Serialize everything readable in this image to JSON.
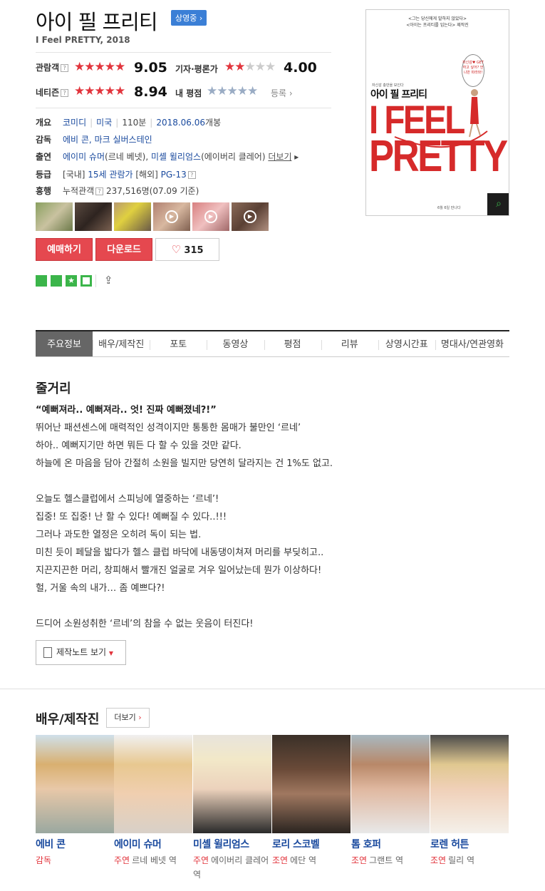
{
  "movie": {
    "title": "아이 필 프리티",
    "status_badge": "상영중",
    "subtitle": "I Feel PRETTY, 2018"
  },
  "ratings": {
    "audience_label": "관람객",
    "audience_score": "9.05",
    "critic_label": "기자·평론가",
    "critic_score": "4.00",
    "netizen_label": "네티즌",
    "netizen_score": "8.94",
    "my_rating_label": "내 평점",
    "register_label": "등록"
  },
  "info": {
    "summary_label": "개요",
    "genre": "코미디",
    "country": "미국",
    "runtime": "110분",
    "release": "2018.06.06",
    "release_suffix": "개봉",
    "director_label": "감독",
    "director": "에비 콘, 마크 실버스테인",
    "cast_label": "출연",
    "cast_1": "에이미 슈머",
    "cast_1_role": "(르네 베넷),",
    "cast_2": "미셸 윌리엄스",
    "cast_2_role": "(에이버리 클레어)",
    "more": "더보기",
    "grade_label": "등급",
    "grade_domestic": "[국내]",
    "grade_domestic_value": "15세 관람가",
    "grade_foreign": "[해외]",
    "grade_foreign_value": "PG-13",
    "boxoffice_label": "흥행",
    "boxoffice_text": "누적관객",
    "boxoffice_value": "237,516명(07.09 기준)"
  },
  "buttons": {
    "reserve": "예매하기",
    "download": "다운로드",
    "likes": "315"
  },
  "poster": {
    "tagline_1": "<그는 당신에게 말하지 않았다>",
    "tagline_2": "<아이는 프리티를 입는다> 제작진",
    "small_text": "자신감 충만을 보인다",
    "korean_title": "아이 필 프리티",
    "big_1": "I FEEL",
    "big_2": "PRETTY",
    "bubble": "자신감♥ GET하고 싶어? 언니만 따라와!",
    "footer": "6월 6일 만나다"
  },
  "tabs": [
    "주요정보",
    "배우/제작진",
    "포토",
    "동영상",
    "평점",
    "리뷰",
    "상영시간표",
    "명대사/연관영화"
  ],
  "synopsis": {
    "heading": "줄거리",
    "tagline": "“예뻐져라.. 예뻐져라.. 엇! 진짜 예뻐졌네?!”",
    "lines": [
      "뛰어난 패션센스에 매력적인 성격이지만 통통한 몸매가 불만인 ‘르네’",
      " 하아.. 예뻐지기만 하면 뭐든 다 할 수 있을 것만 같다.",
      " 하늘에 온 마음을 담아 간절히 소원을 빌지만 당연히 달라지는 건 1%도 없고.",
      "",
      " 오늘도 헬스클럽에서 스피닝에 열중하는 ‘르네’!",
      " 집중! 또 집중! 난 할 수 있다! 예뻐질 수 있다..!!!",
      " 그러나 과도한 열정은 오히려 독이 되는 법.",
      " 미친 듯이 페달을 밟다가 헬스 클럽 바닥에 내동댕이쳐져 머리를 부딪히고..",
      " 지끈지끈한 머리, 창피해서 빨개진 얼굴로 겨우 일어났는데 뭔가 이상하다!",
      " 헐, 거울 속의 내가… 좀 예쁘다?!",
      "",
      " 드디어 소원성취한 ‘르네’의 참을 수 없는 웃음이 터진다!"
    ],
    "note_button": "제작노트 보기"
  },
  "cast_section": {
    "heading": "배우/제작진",
    "more": "더보기",
    "people": [
      {
        "name": "에비 콘",
        "role_kind": "감독",
        "role": ""
      },
      {
        "name": "에이미 슈머",
        "role_kind": "주연",
        "role": "르네 베넷 역"
      },
      {
        "name": "미셸 윌리엄스",
        "role_kind": "주연",
        "role": "에이버리 클레어 역"
      },
      {
        "name": "로리 스코벨",
        "role_kind": "조연",
        "role": "에단 역"
      },
      {
        "name": "톰 호퍼",
        "role_kind": "조연",
        "role": "그랜트 역"
      },
      {
        "name": "로렌 허튼",
        "role_kind": "조연",
        "role": "릴리 역"
      }
    ]
  },
  "colors": {
    "accent_red": "#e5484f",
    "link_blue": "#1a4a9e",
    "badge_blue": "#3b7fd6"
  }
}
